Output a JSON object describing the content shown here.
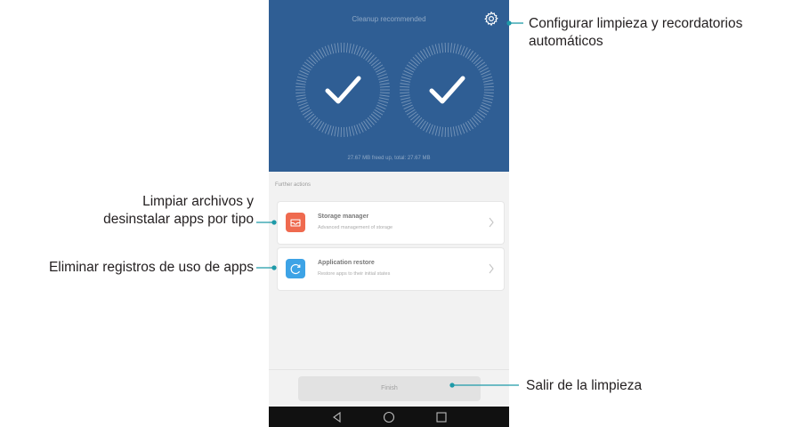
{
  "app": {
    "hero_title": "Cleanup recommended",
    "hero_status": "27.67 MB freed up, total: 27.67 MB",
    "section_label": "Further actions",
    "cards": [
      {
        "title": "Storage manager",
        "subtitle": "Advanced management of storage",
        "icon": "storage-drawer-icon",
        "color": "#ef6a4f"
      },
      {
        "title": "Application restore",
        "subtitle": "Restore apps to their initial states",
        "icon": "restore-icon",
        "color": "#3da3e6"
      }
    ],
    "finish_label": "Finish",
    "colors": {
      "hero_bg": "#2f5e94",
      "callout_line": "#1e9aa8"
    }
  },
  "annotations": {
    "settings_line1": "Configurar limpieza y recordatorios",
    "settings_line2": "automáticos",
    "storage_line1": "Limpiar archivos y",
    "storage_line2": "desinstalar apps por tipo",
    "restore": "Eliminar registros de uso de apps",
    "finish": "Salir de la limpieza"
  }
}
